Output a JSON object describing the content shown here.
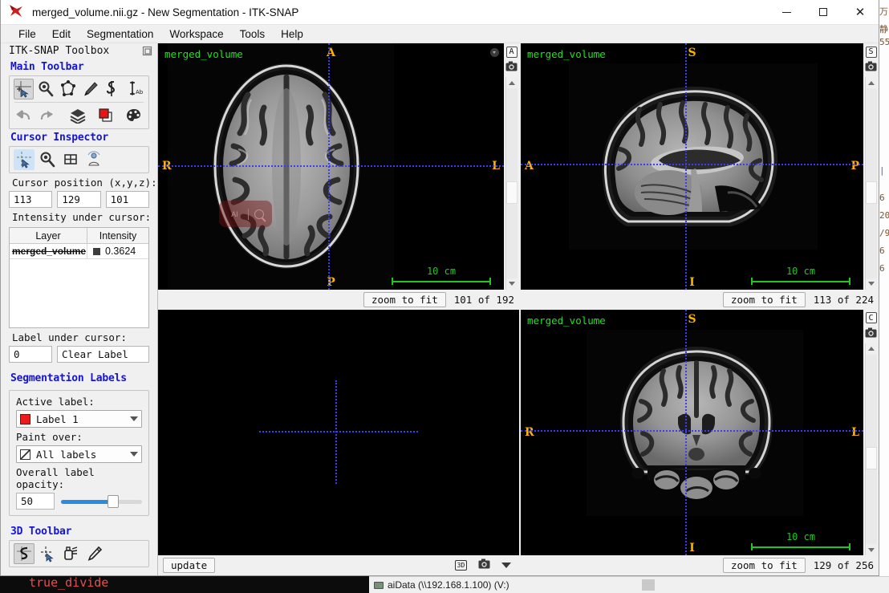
{
  "window": {
    "title": "merged_volume.nii.gz - New Segmentation - ITK-SNAP",
    "app_icon": "itksnap-logo-icon",
    "minimize_label": "–",
    "maximize_label": "□",
    "close_label": "✕"
  },
  "menubar": {
    "items": [
      "File",
      "Edit",
      "Segmentation",
      "Workspace",
      "Tools",
      "Help"
    ]
  },
  "toolbox": {
    "header": "ITK-SNAP Toolbox",
    "undock_icon": "undock-icon",
    "sections": {
      "main_toolbar": {
        "title": "Main Toolbar",
        "row1": [
          {
            "name": "crosshair-tool-icon",
            "active": true
          },
          {
            "name": "zoom-pan-tool-icon",
            "active": false
          },
          {
            "name": "polygon-tool-icon",
            "active": false
          },
          {
            "name": "paintbrush-tool-icon",
            "active": false
          },
          {
            "name": "snake-tool-icon",
            "active": false
          },
          {
            "name": "annotation-tool-icon",
            "active": false
          }
        ],
        "row2": [
          {
            "name": "undo-icon",
            "active": false
          },
          {
            "name": "redo-icon",
            "active": false
          },
          {
            "name": "layers-icon",
            "active": false
          },
          {
            "name": "overlay-color-icon",
            "active": false
          },
          {
            "name": "palette-icon",
            "active": false
          }
        ]
      },
      "cursor_inspector": {
        "title": "Cursor Inspector",
        "tabs": [
          {
            "name": "cursor-inspector-tab-icon",
            "active": true
          },
          {
            "name": "zoom-inspector-tab-icon",
            "active": false
          },
          {
            "name": "grid-inspector-tab-icon",
            "active": false
          },
          {
            "name": "registration-inspector-tab-icon",
            "active": false
          }
        ],
        "cursor_position_label": "Cursor position (x,y,z):",
        "cursor_position": [
          "113",
          "129",
          "101"
        ],
        "intensity_label": "Intensity under cursor:",
        "table_headers": [
          "Layer",
          "Intensity"
        ],
        "table_rows": [
          {
            "layer": "merged_volume",
            "swatch": "#3d3d3d",
            "intensity": "0.3624"
          }
        ],
        "label_under_cursor_label": "Label under cursor:",
        "label_id": "0",
        "label_name": "Clear Label"
      },
      "segmentation_labels": {
        "title": "Segmentation Labels",
        "active_label_caption": "Active label:",
        "active_label_value": "Label 1",
        "active_label_color": "#ec1c1c",
        "paint_over_caption": "Paint over:",
        "paint_over_value": "All labels",
        "opacity_caption": "Overall label opacity:",
        "opacity_value": "50"
      },
      "toolbar_3d": {
        "title": "3D Toolbar",
        "buttons": [
          {
            "name": "3d-trackball-icon",
            "active": true
          },
          {
            "name": "3d-crosshair-icon",
            "active": false
          },
          {
            "name": "3d-spray-icon",
            "active": false
          },
          {
            "name": "3d-scalpel-icon",
            "active": false
          }
        ]
      }
    }
  },
  "views": {
    "axial": {
      "layer_name": "merged_volume",
      "orientation_letters": {
        "top": "A",
        "bottom": "P",
        "left": "R",
        "right": "L"
      },
      "scalebar_label": "10 cm",
      "zoom_button": "zoom to fit",
      "slice_text": "101 of 192",
      "rail_letter": "A",
      "camera_icon": "camera-icon",
      "menu_dot_icon": "panel-menu-icon",
      "watermark": "AI | search watermark"
    },
    "sagittal": {
      "layer_name": "merged_volume",
      "orientation_letters": {
        "top": "S",
        "bottom": "I",
        "left": "A",
        "right": "P"
      },
      "scalebar_label": "10 cm",
      "zoom_button": "zoom to fit",
      "slice_text": "113 of 224",
      "rail_letter": "S",
      "camera_icon": "camera-icon"
    },
    "threed": {
      "update_button": "update",
      "icons": [
        "3d-view-icon",
        "camera-icon",
        "chevron-down-icon"
      ]
    },
    "coronal": {
      "layer_name": "merged_volume",
      "orientation_letters": {
        "top": "S",
        "bottom": "I",
        "left": "R",
        "right": "L"
      },
      "scalebar_label": "10 cm",
      "zoom_button": "zoom to fit",
      "slice_text": "129 of 256",
      "rail_letter": "C",
      "camera_icon": "camera-icon"
    }
  },
  "background": {
    "console_text": "true_divide",
    "taskbar_item": "aiData (\\\\192.168.1.100) (V:)"
  },
  "colors": {
    "crosshair": "#3b3bff",
    "layer_name": "#21e021",
    "orientation": "#ffb100",
    "scalebar": "#22c522",
    "section_title": "#1414d6",
    "active_label": "#ec1c1c",
    "slider_fill": "#2a8ce0"
  }
}
